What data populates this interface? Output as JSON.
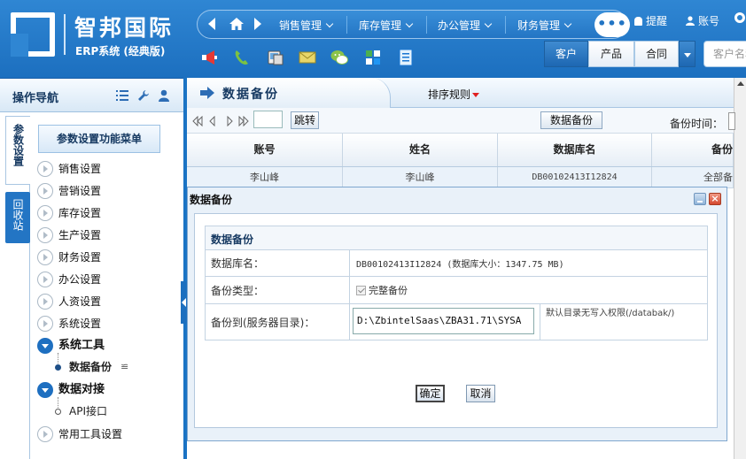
{
  "brand": {
    "title": "智邦国际",
    "subtitle": "ERP系统 (经典版)"
  },
  "topnav": {
    "items": [
      "销售管理",
      "库存管理",
      "办公管理",
      "财务管理"
    ],
    "more": "•••"
  },
  "header_right": {
    "remind": "提醒",
    "account": "账号"
  },
  "toolbar_icons": [
    "megaphone-icon",
    "phone-icon",
    "device-icon",
    "mail-icon",
    "wechat-icon",
    "grid-icon",
    "document-icon"
  ],
  "segments": {
    "items": [
      "客户",
      "产品",
      "合同"
    ],
    "active": "客户"
  },
  "search": {
    "placeholder": "客户名称"
  },
  "sidebar": {
    "title": "操作导航",
    "vtabs": [
      "参数设置",
      "回收站"
    ],
    "menu_button": "参数设置功能菜单",
    "items": [
      "销售设置",
      "营销设置",
      "库存设置",
      "生产设置",
      "财务设置",
      "办公设置",
      "人资设置",
      "系统设置"
    ],
    "system_tools": {
      "label": "系统工具",
      "children": [
        "数据备份"
      ]
    },
    "data_link": {
      "label": "数据对接",
      "children": [
        "API接口"
      ]
    },
    "common_tools": "常用工具设置"
  },
  "main": {
    "page_title": "数据备份",
    "sort_rule": "排序规则",
    "jump_button": "跳转",
    "backup_button": "数据备份",
    "backup_time_label": "备份时间：",
    "table": {
      "headers": [
        "账号",
        "姓名",
        "数据库名",
        "备份"
      ],
      "rows": [
        [
          "李山峰",
          "李山峰",
          "DB00102413I12824",
          "全部备"
        ]
      ]
    }
  },
  "dialog": {
    "title": "数据备份",
    "form_title": "数据备份",
    "db_label": "数据库名：",
    "db_value": "DB00102413I12824 (数据库大小：1347.75 MB)",
    "type_label": "备份类型：",
    "type_value": "完整备份",
    "path_label": "备份到(服务器目录)：",
    "path_value": "D:\\ZbintelSaas\\ZBA31.71\\SYSA",
    "path_note": "默认目录无写入权限(/databak/)",
    "ok": "确定",
    "cancel": "取消"
  }
}
